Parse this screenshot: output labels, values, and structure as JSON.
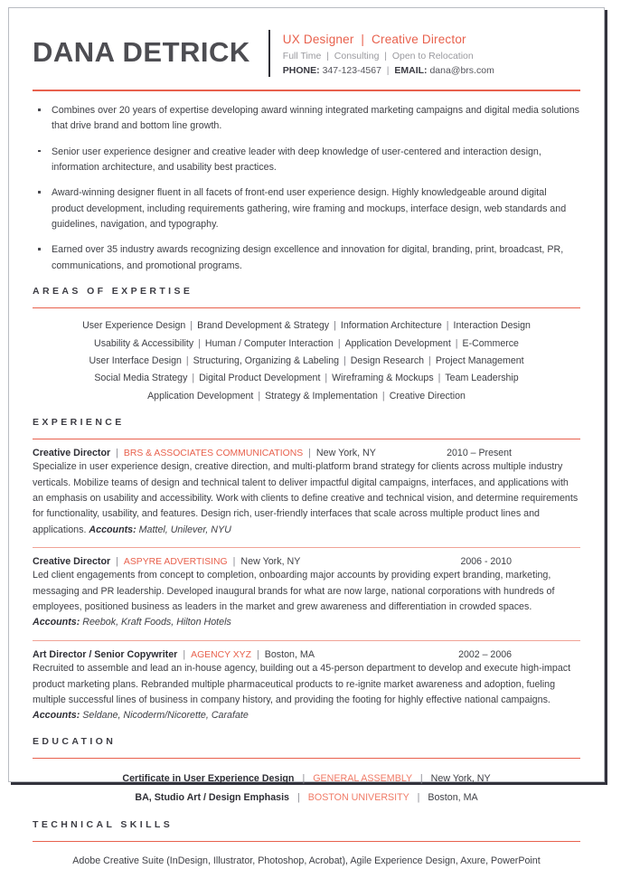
{
  "header": {
    "name": "DANA DETRICK",
    "titles": [
      "UX Designer",
      "Creative Director"
    ],
    "availability": [
      "Full Time",
      "Consulting",
      "Open to Relocation"
    ],
    "phone_label": "PHONE:",
    "phone": "347-123-4567",
    "email_label": "EMAIL:",
    "email": "dana@brs.com",
    "separator": "|"
  },
  "summary": {
    "bullets": [
      "Combines over 20 years of expertise developing award winning integrated marketing campaigns and digital media solutions that drive brand and bottom line growth.",
      "Senior user experience designer and creative leader with deep knowledge of user-centered and interaction design, information architecture, and usability best practices.",
      "Award-winning designer fluent in all facets of front-end user experience design. Highly knowledgeable around digital product development, including requirements gathering, wire framing and mockups, interface design, web standards and guidelines, navigation, and typography.",
      "Earned over 35 industry awards recognizing design excellence and innovation for digital, branding, print, broadcast, PR, communications, and promotional programs."
    ]
  },
  "expertise": {
    "heading": "AREAS OF EXPERTISE",
    "rows": [
      [
        "User Experience Design",
        "Brand Development & Strategy",
        "Information Architecture",
        "Interaction Design"
      ],
      [
        "Usability & Accessibility",
        "Human / Computer Interaction",
        "Application Development",
        "E-Commerce"
      ],
      [
        "User Interface Design",
        "Structuring, Organizing & Labeling",
        "Design Research",
        "Project Management"
      ],
      [
        "Social Media Strategy",
        "Digital Product Development",
        "Wireframing & Mockups",
        "Team Leadership"
      ],
      [
        "Application Development",
        "Strategy & Implementation",
        "Creative Direction"
      ]
    ]
  },
  "experience": {
    "heading": "EXPERIENCE",
    "jobs": [
      {
        "title": "Creative Director",
        "company": "BRS & ASSOCIATES COMMUNICATIONS",
        "location": "New York, NY",
        "dates": "2010 – Present",
        "description": "Specialize in user experience design, creative direction, and multi-platform brand strategy for clients across multiple industry verticals. Mobilize teams of design and technical talent to deliver impactful digital campaigns, interfaces, and applications with an emphasis on usability and accessibility. Work with clients to define creative and technical vision, and determine requirements for functionality, usability, and features. Design rich, user-friendly interfaces that scale across multiple product lines and applications.",
        "accounts_label": "Accounts:",
        "accounts": "Mattel, Unilever, NYU"
      },
      {
        "title": "Creative Director",
        "company": "ASPYRE ADVERTISING",
        "location": "New York, NY",
        "dates": "2006 - 2010",
        "description": "Led client engagements from concept to completion, onboarding major accounts by providing expert branding, marketing, messaging and PR leadership. Developed inaugural brands for what are now large, national corporations with hundreds of employees, positioned business as leaders in the market and grew awareness and differentiation in crowded spaces.",
        "accounts_label": "Accounts:",
        "accounts": "Reebok, Kraft Foods, Hilton Hotels"
      },
      {
        "title": "Art Director / Senior Copywriter",
        "company": "AGENCY XYZ",
        "location": "Boston, MA",
        "dates": "2002 – 2006",
        "description": "Recruited to assemble and lead an in-house agency, building out a 45-person department to develop and execute high-impact product marketing plans. Rebranded multiple pharmaceutical products to re-ignite market awareness and adoption, fueling multiple successful lines of business in company history, and providing the footing for highly effective national campaigns.",
        "accounts_label": "Accounts:",
        "accounts": "Seldane, Nicoderm/Nicorette, Carafate"
      }
    ]
  },
  "education": {
    "heading": "EDUCATION",
    "entries": [
      {
        "degree": "Certificate in User Experience Design",
        "school": "GENERAL ASSEMBLY",
        "location": "New York, NY"
      },
      {
        "degree": "BA, Studio Art / Design Emphasis",
        "school": "BOSTON UNIVERSITY",
        "location": "Boston, MA"
      }
    ]
  },
  "skills": {
    "heading": "TECHNICAL SKILLS",
    "text": "Adobe Creative Suite (InDesign, Illustrator, Photoshop, Acrobat), Agile Experience Design, Axure, PowerPoint"
  },
  "colors": {
    "accent": "#e8614d",
    "accent_soft": "#f0a396",
    "name": "#4d4d52",
    "body": "#3f4046",
    "muted": "#9a9a9f"
  }
}
